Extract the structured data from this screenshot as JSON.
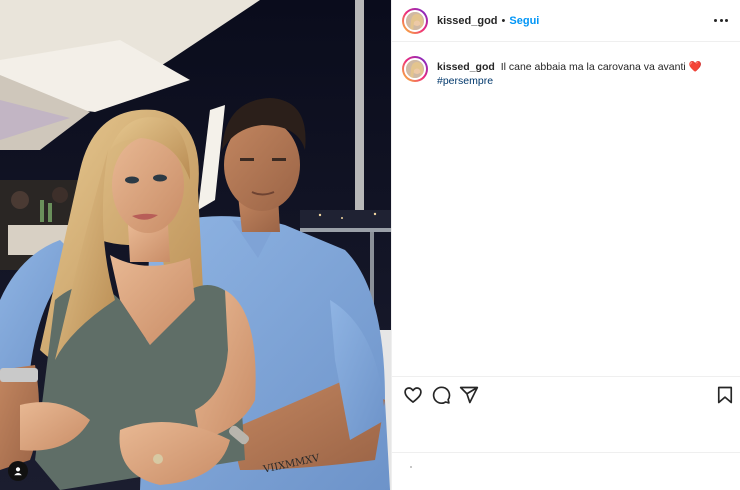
{
  "post": {
    "username": "kissed_god",
    "separator": "•",
    "follow_label": "Segui"
  },
  "caption": {
    "username": "kissed_god",
    "text": "Il cane abbaia ma la carovana va avanti",
    "emoji": "❤️",
    "hashtag": "#persempre"
  },
  "photo": {
    "tattoo_text": "VIIXMMXV"
  },
  "icons": {
    "more": "more-options-icon",
    "like": "heart-icon",
    "comment": "comment-icon",
    "share": "share-icon",
    "save": "bookmark-icon",
    "tags": "user-tag-icon"
  },
  "colors": {
    "accent": "#0095f6",
    "text": "#262626",
    "hashtag": "#00376b",
    "heart": "#e0245e"
  }
}
